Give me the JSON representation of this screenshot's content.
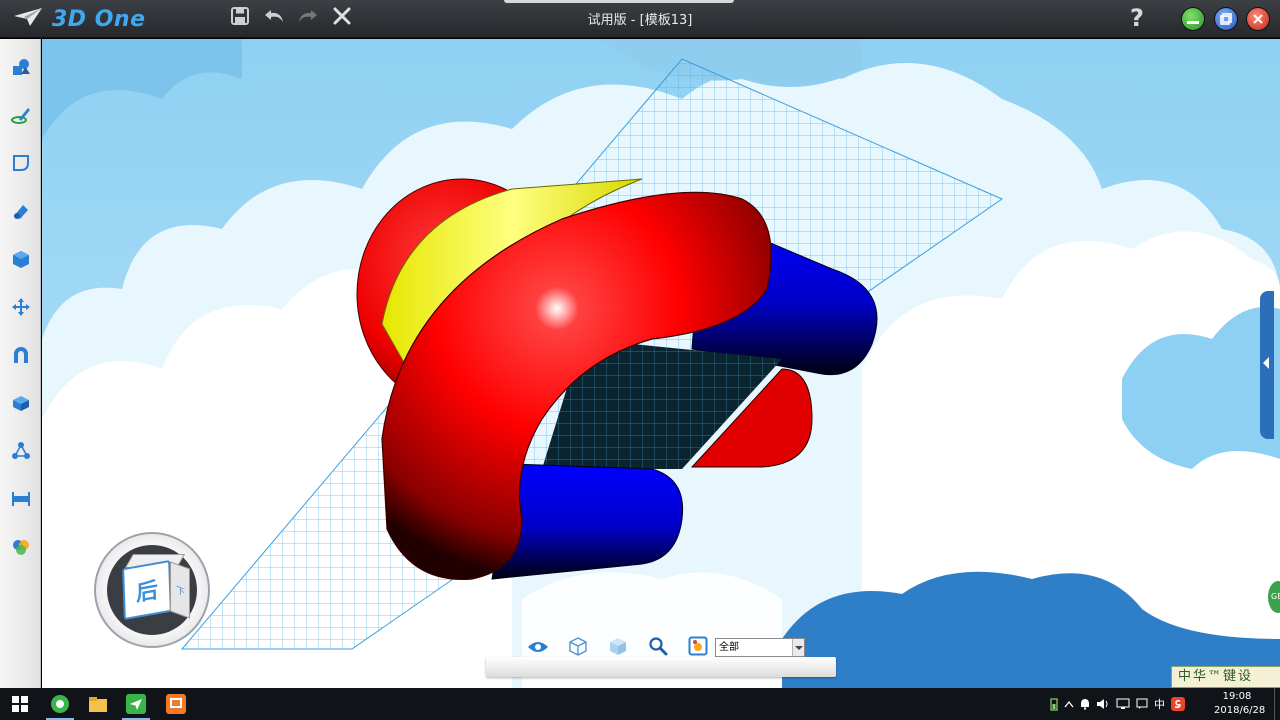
{
  "app": {
    "brand": "3D One",
    "document_title": "试用版 - [模板13]"
  },
  "titlebar": {
    "quick_actions": [
      "save-icon",
      "undo-icon",
      "redo-icon",
      "close-x-icon"
    ],
    "help_label": "?",
    "window_buttons": [
      {
        "name": "minimize",
        "color": "#3aa435"
      },
      {
        "name": "restore",
        "color": "#2f6fcf"
      },
      {
        "name": "close",
        "color": "#d83a2e"
      }
    ]
  },
  "left_toolbar": {
    "tools": [
      "basic-shapes-icon",
      "sketch-icon",
      "sketch-edit-icon",
      "special-features-icon",
      "feature-modeling-icon",
      "move-icon",
      "combine-icon",
      "solid-icon",
      "pattern-icon",
      "measure-icon",
      "materials-icon"
    ]
  },
  "view_cube": {
    "face_label": "后",
    "side_label": "下"
  },
  "view_tools": {
    "icons": [
      "eye-icon",
      "wireframe-cube-icon",
      "shaded-cube-icon",
      "zoom-icon",
      "image-icon"
    ],
    "filter_value": "全部"
  },
  "colors": {
    "sky": "#a7dcf6",
    "cloud": "#ffffff",
    "model_red": "#ff0000",
    "model_yellow": "#ffff00",
    "model_blue": "#0000ff",
    "grid_line": "#5bb7e8"
  },
  "edge_badge": "GB",
  "stamp": "中华™键设",
  "taskbar": {
    "apps": [
      "windows-start-icon",
      "green-browser-icon",
      "file-explorer-icon",
      "telegram-icon",
      "presentation-app-icon"
    ],
    "tray": {
      "input_method": "中",
      "time": "19:08",
      "date": "2018/6/28"
    }
  }
}
